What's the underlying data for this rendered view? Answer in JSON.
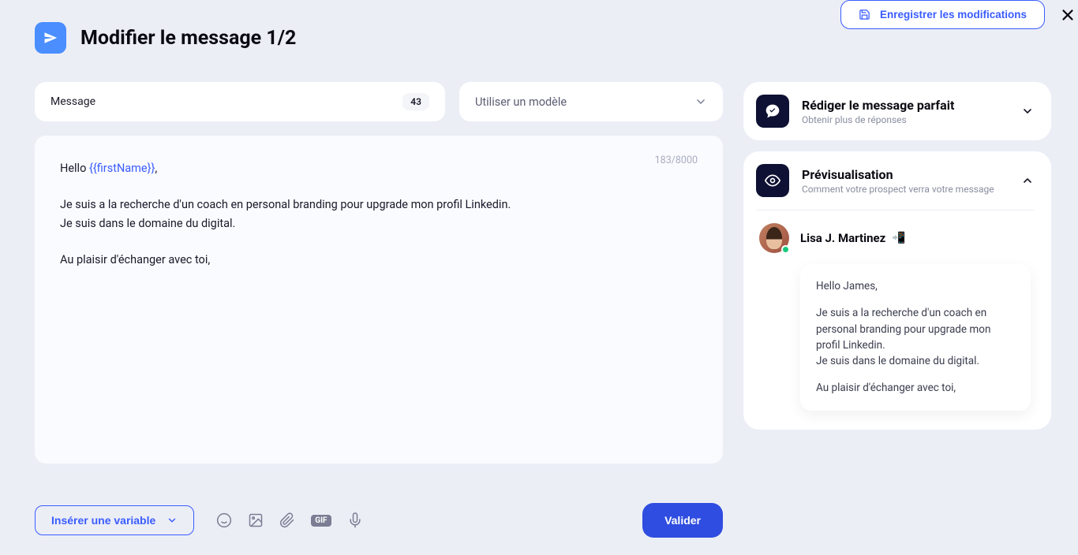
{
  "topbar": {
    "save_label": "Enregistrer les modifications"
  },
  "header": {
    "title": "Modifier le message 1/2"
  },
  "message_box": {
    "label": "Message",
    "badge": "43"
  },
  "template_select": {
    "placeholder": "Utiliser un modèle"
  },
  "editor": {
    "char_count": "183/8000",
    "greeting_prefix": "Hello ",
    "variable_token": "{{firstName}}",
    "greeting_suffix": ",",
    "body_line1": "Je suis a la recherche d'un coach en personal branding pour upgrade mon profil Linkedin.",
    "body_line2": "Je suis dans le domaine du digital.",
    "closing": "Au plaisir d'échanger avec toi,"
  },
  "toolbar": {
    "insert_variable_label": "Insérer une variable",
    "validate_label": "Valider",
    "gif_label": "GIF"
  },
  "tips_card": {
    "title": "Rédiger le message parfait",
    "subtitle": "Obtenir plus de réponses"
  },
  "preview_card": {
    "title": "Prévisualisation",
    "subtitle": "Comment votre prospect verra votre message",
    "person_name": "Lisa J. Martinez",
    "person_emoji": "📲",
    "message_greeting": "Hello James,",
    "message_body1": "Je suis a la recherche d'un coach en personal branding pour upgrade mon profil Linkedin.",
    "message_body2": "Je suis dans le domaine du digital.",
    "message_closing": "Au plaisir d'échanger avec toi,"
  }
}
